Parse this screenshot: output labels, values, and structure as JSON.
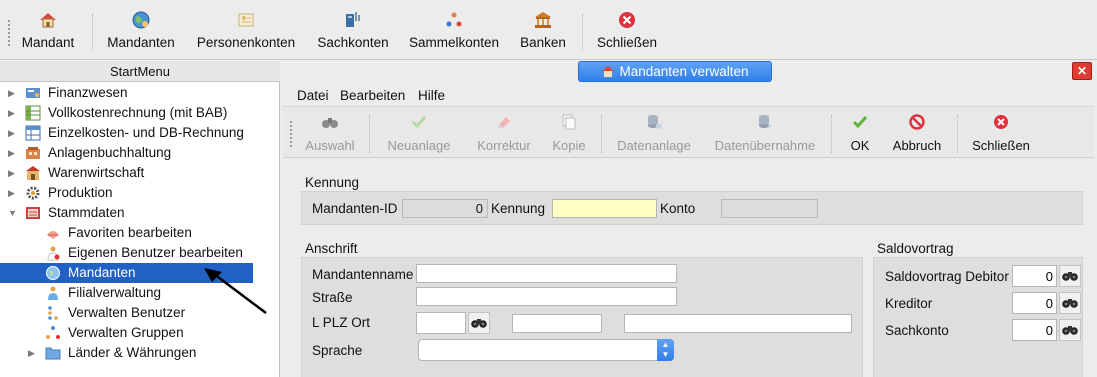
{
  "toolbar": {
    "items": [
      {
        "label": "Mandant",
        "icon": "house-icon"
      },
      {
        "label": "Mandanten",
        "icon": "globe-icon"
      },
      {
        "label": "Personenkonten",
        "icon": "person-card-icon"
      },
      {
        "label": "Sachkonten",
        "icon": "ledger-icon"
      },
      {
        "label": "Sammelkonten",
        "icon": "collection-icon"
      },
      {
        "label": "Banken",
        "icon": "bank-icon"
      },
      {
        "label": "Schließen",
        "icon": "close-icon"
      }
    ]
  },
  "start_menu": {
    "title": "StartMenu",
    "items": [
      {
        "label": "Finanzwesen",
        "icon": "finance-icon"
      },
      {
        "label": "Vollkostenrechnung (mit BAB)",
        "icon": "spreadsheet-icon"
      },
      {
        "label": "Einzelkosten- und DB-Rechnung",
        "icon": "table-icon"
      },
      {
        "label": "Anlagenbuchhaltung",
        "icon": "assets-icon"
      },
      {
        "label": "Warenwirtschaft",
        "icon": "warehouse-icon"
      },
      {
        "label": "Produktion",
        "icon": "production-icon"
      },
      {
        "label": "Stammdaten",
        "icon": "master-data-icon"
      },
      {
        "label": "Favoriten bearbeiten",
        "icon": "favorites-icon"
      },
      {
        "label": "Eigenen Benutzer bearbeiten",
        "icon": "user-edit-icon"
      },
      {
        "label": "Mandanten",
        "icon": "globe-icon"
      },
      {
        "label": "Filialverwaltung",
        "icon": "branch-icon"
      },
      {
        "label": "Verwalten Benutzer",
        "icon": "users-icon"
      },
      {
        "label": "Verwalten Gruppen",
        "icon": "groups-icon"
      },
      {
        "label": "Länder & Währungen",
        "icon": "folder-icon"
      }
    ]
  },
  "window": {
    "title": "Mandanten verwalten",
    "menu": [
      "Datei",
      "Bearbeiten",
      "Hilfe"
    ],
    "toolbar": [
      {
        "label": "Auswahl",
        "icon": "binoculars-icon",
        "enabled": false
      },
      {
        "label": "Neuanlage",
        "icon": "checkmark-icon",
        "enabled": false
      },
      {
        "label": "Korrektur",
        "icon": "eraser-icon",
        "enabled": false
      },
      {
        "label": "Kopie",
        "icon": "copy-icon",
        "enabled": false
      },
      {
        "label": "Datenanlage",
        "icon": "database-add-icon",
        "enabled": false
      },
      {
        "label": "Datenübernahme",
        "icon": "database-import-icon",
        "enabled": false
      },
      {
        "label": "OK",
        "icon": "checkmark-icon",
        "enabled": true
      },
      {
        "label": "Abbruch",
        "icon": "cancel-icon",
        "enabled": true
      },
      {
        "label": "Schließen",
        "icon": "close-icon",
        "enabled": true
      }
    ]
  },
  "form": {
    "kennung_section": "Kennung",
    "mandanten_id_label": "Mandanten-ID",
    "mandanten_id_value": "0",
    "kennung_label": "Kennung",
    "kennung_value": "",
    "konto_label": "Konto",
    "konto_value": "",
    "anschrift_section": "Anschrift",
    "mandantenname_label": "Mandantenname",
    "strasse_label": "Straße",
    "lplzort_label": "L PLZ Ort",
    "sprache_label": "Sprache",
    "saldo_section": "Saldovortrag",
    "saldo_debitor_label": "Saldovortrag Debitor",
    "saldo_debitor_value": "0",
    "kreditor_label": "Kreditor",
    "kreditor_value": "0",
    "sachkonto_label": "Sachkonto",
    "sachkonto_value": "0"
  },
  "colors": {
    "selection": "#2160c4",
    "title_blue": "#2f7fe8",
    "close_red": "#e23b31",
    "kennung_yellow": "#ffffc4"
  }
}
